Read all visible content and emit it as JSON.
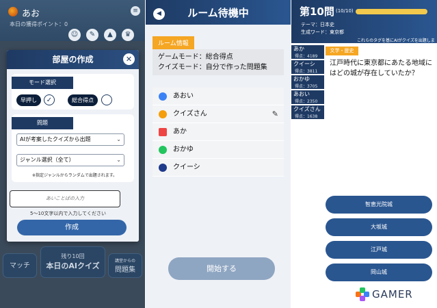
{
  "panel1": {
    "user_name": "あお",
    "points_label": "本日の獲得ポイント：0",
    "menu_icon": "menu-icon",
    "toolbar_icons": [
      "person-icon",
      "book-icon",
      "chart-icon",
      "crown-icon"
    ],
    "modal": {
      "title": "部屋の作成",
      "mode_label": "モード選択",
      "mode_options": [
        "早押し",
        "総合得点"
      ],
      "mode_checked": "早押し",
      "question_label": "問題",
      "question_source": "AIが考案したクイズから出題",
      "genre_select": "ジャンル選択（全て）",
      "genre_note": "※指定ジャンルからランダムで出題されます。",
      "keyword_placeholder": "あいことばの入力",
      "keyword_note": "5〜10文字以内で入力してください",
      "create_button": "作成"
    },
    "bottom": {
      "match": "マッチ",
      "remaining": "残り10回",
      "daily": "本日のAIクイズ",
      "custom_top": "講堂からの",
      "custom": "問題集"
    }
  },
  "panel2": {
    "title": "ルーム待機中",
    "info_tag": "ルーム情報",
    "game_mode": "ゲームモード：総合得点",
    "quiz_mode": "クイズモード：自分で作った問題集",
    "members": [
      {
        "name": "あおい",
        "color": "#3b82f6"
      },
      {
        "name": "クイズさん",
        "color": "#f59e0b"
      },
      {
        "name": "あか",
        "color": "#ef4444"
      },
      {
        "name": "おかゆ",
        "color": "#22c55e"
      },
      {
        "name": "クイーシ",
        "color": "#1e3a8a"
      }
    ],
    "start_button": "開始する"
  },
  "panel3": {
    "question_number": "第10問",
    "question_count": "(10/10)",
    "progress": 1.0,
    "theme": "テーマ：日本史",
    "seed_word": "生成ワード：東京都",
    "instruction": "これらのタグを基にAIがクイズを出題しました。",
    "scores": [
      {
        "name": "あか",
        "points": "得点：4189"
      },
      {
        "name": "クイーシ",
        "points": "得点：3811"
      },
      {
        "name": "おかゆ",
        "points": "得点：3705"
      },
      {
        "name": "あおい",
        "points": "得点：2350"
      },
      {
        "name": "クイズさん",
        "points": "得点：1638"
      }
    ],
    "category": "文学・歴史",
    "question": "江戸時代に東京都にあたる地域にはどの城が存在していたか？",
    "answers": [
      "智恵光院城",
      "大坂城",
      "江戸城",
      "岡山城"
    ]
  },
  "watermark": "GAMER"
}
